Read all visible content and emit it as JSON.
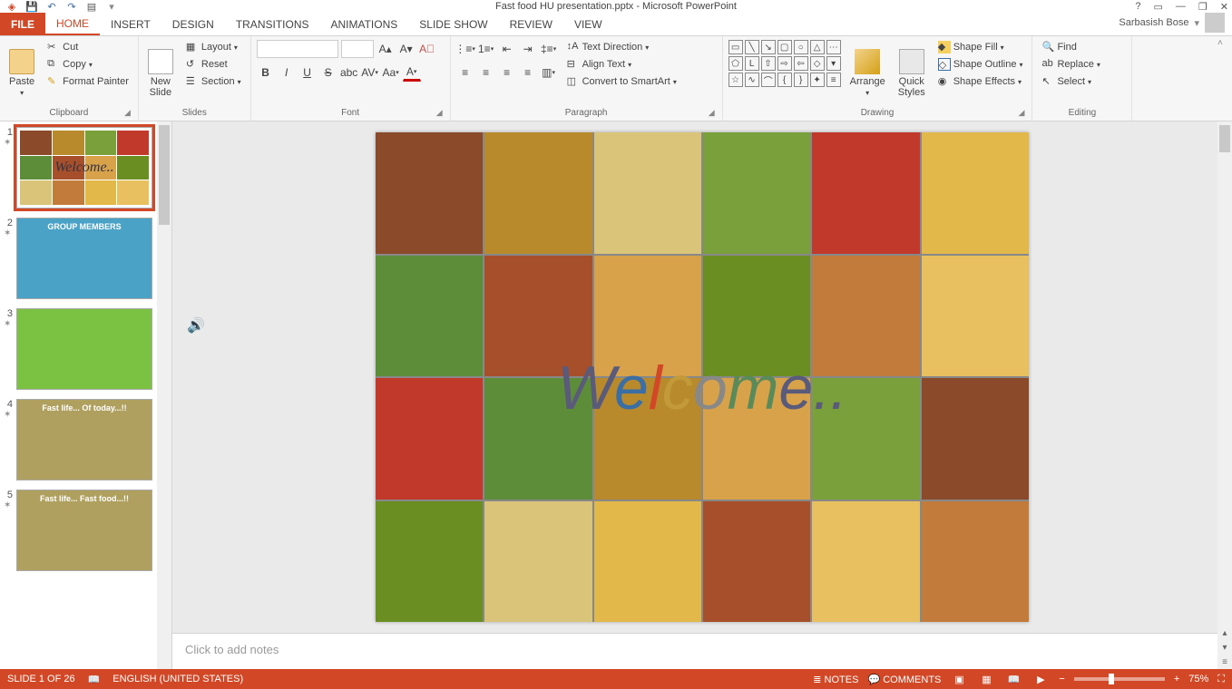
{
  "app": {
    "title": "Fast food HU presentation.pptx - Microsoft PowerPoint"
  },
  "window_controls": {
    "help": "?",
    "ribbon_opts": "▭",
    "minimize": "—",
    "restore": "❐",
    "close": "✕"
  },
  "account": {
    "name": "Sarbasish Bose"
  },
  "tabs": {
    "file": "FILE",
    "home": "HOME",
    "insert": "INSERT",
    "design": "DESIGN",
    "transitions": "TRANSITIONS",
    "animations": "ANIMATIONS",
    "slideshow": "SLIDE SHOW",
    "review": "REVIEW",
    "view": "VIEW"
  },
  "ribbon": {
    "clipboard": {
      "label": "Clipboard",
      "paste": "Paste",
      "cut": "Cut",
      "copy": "Copy",
      "format_painter": "Format Painter"
    },
    "slides": {
      "label": "Slides",
      "new_slide": "New\nSlide",
      "layout": "Layout",
      "reset": "Reset",
      "section": "Section"
    },
    "font": {
      "label": "Font",
      "font_name": "",
      "font_size": ""
    },
    "paragraph": {
      "label": "Paragraph",
      "text_direction": "Text Direction",
      "align_text": "Align Text",
      "convert_smartart": "Convert to SmartArt"
    },
    "drawing": {
      "label": "Drawing",
      "arrange": "Arrange",
      "quick_styles": "Quick\nStyles",
      "shape_fill": "Shape Fill",
      "shape_outline": "Shape Outline",
      "shape_effects": "Shape Effects"
    },
    "editing": {
      "label": "Editing",
      "find": "Find",
      "replace": "Replace",
      "select": "Select"
    }
  },
  "thumbnails": [
    {
      "num": "1",
      "title": "Welcome..",
      "bg": "collage"
    },
    {
      "num": "2",
      "title": "GROUP MEMBERS",
      "bg": "#4aa3c7"
    },
    {
      "num": "3",
      "title": "",
      "bg": "#7cc242"
    },
    {
      "num": "4",
      "title": "Fast life... Of today...!!",
      "bg": "#b0a060"
    },
    {
      "num": "5",
      "title": "Fast life... Fast food...!!",
      "bg": "#b0a060"
    }
  ],
  "slide": {
    "welcome_text": "Welcome.."
  },
  "notes": {
    "placeholder": "Click to add notes"
  },
  "status": {
    "slide_indicator": "SLIDE 1 OF 26",
    "language": "ENGLISH (UNITED STATES)",
    "notes": "NOTES",
    "comments": "COMMENTS",
    "zoom": "75%"
  }
}
